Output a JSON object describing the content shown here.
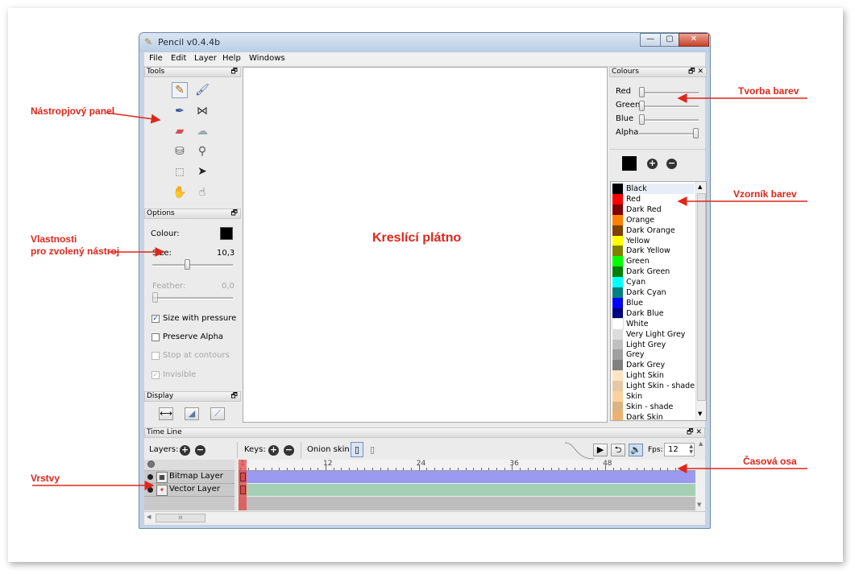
{
  "window": {
    "title": "Pencil v0.4.4b",
    "min": "—",
    "max": "▢",
    "close": "✕"
  },
  "menu": [
    "File",
    "Edit",
    "Layer",
    "Help",
    "Windows"
  ],
  "tools_panel": {
    "title": "Tools",
    "float": "🗗"
  },
  "options_panel": {
    "title": "Options",
    "float": "🗗",
    "colour_label": "Colour:",
    "colour_value": "#000000",
    "size_label": "Size:",
    "size_value": "10,3",
    "size_fraction": 0.43,
    "feather_label": "Feather:",
    "feather_value": "0,0",
    "checks": [
      {
        "label": "Size with pressure",
        "checked": true,
        "disabled": false
      },
      {
        "label": "Preserve Alpha",
        "checked": false,
        "disabled": false
      },
      {
        "label": "Stop at contours",
        "checked": false,
        "disabled": true
      },
      {
        "label": "Invisible",
        "checked": true,
        "disabled": true
      }
    ]
  },
  "display_panel": {
    "title": "Display",
    "float": "🗗",
    "btn1": "⟷",
    "btn2": "◢",
    "btn3": "⟋"
  },
  "colours_panel": {
    "title": "Colours",
    "float": "🗗",
    "close": "✕",
    "sliders": [
      {
        "label": "Red",
        "fraction": 0.0
      },
      {
        "label": "Green",
        "fraction": 0.0
      },
      {
        "label": "Blue",
        "fraction": 0.0
      },
      {
        "label": "Alpha",
        "fraction": 1.0
      }
    ],
    "current": "#000000",
    "add": "+",
    "remove": "−"
  },
  "swatches": [
    {
      "name": "Black",
      "color": "#000000"
    },
    {
      "name": "Red",
      "color": "#ff0000"
    },
    {
      "name": "Dark Red",
      "color": "#800000"
    },
    {
      "name": "Orange",
      "color": "#ff8000"
    },
    {
      "name": "Dark Orange",
      "color": "#804000"
    },
    {
      "name": "Yellow",
      "color": "#ffff00"
    },
    {
      "name": "Dark Yellow",
      "color": "#808000"
    },
    {
      "name": "Green",
      "color": "#00ff00"
    },
    {
      "name": "Dark Green",
      "color": "#008000"
    },
    {
      "name": "Cyan",
      "color": "#00ffff"
    },
    {
      "name": "Dark Cyan",
      "color": "#008080"
    },
    {
      "name": "Blue",
      "color": "#0000ff"
    },
    {
      "name": "Dark Blue",
      "color": "#000080"
    },
    {
      "name": "White",
      "color": "#ffffff"
    },
    {
      "name": "Very Light Grey",
      "color": "#dcdcdc"
    },
    {
      "name": "Light Grey",
      "color": "#c0c0c0"
    },
    {
      "name": "Grey",
      "color": "#a0a0a0"
    },
    {
      "name": "Dark Grey",
      "color": "#808080"
    },
    {
      "name": "Light Skin",
      "color": "#ffe4c4"
    },
    {
      "name": "Light Skin - shade",
      "color": "#e6c8a6"
    },
    {
      "name": "Skin",
      "color": "#fad2a0"
    },
    {
      "name": "Skin - shade",
      "color": "#dcb482"
    },
    {
      "name": "Dark Skin",
      "color": "#f0b070"
    }
  ],
  "timeline": {
    "title": "Time Line",
    "float": "🗗",
    "close": "✕",
    "layers_label": "Layers:",
    "keys_label": "Keys:",
    "onion_label": "Onion skin:",
    "fps_label": "Fps:",
    "fps_value": "12",
    "play": "▶",
    "loop": "⮌",
    "sound": "🔈",
    "frame_ticks": [
      "1",
      "12",
      "24",
      "36",
      "48"
    ],
    "layers": [
      {
        "name": "Bitmap Layer",
        "color": "#9a9af2"
      },
      {
        "name": "Vector Layer",
        "color": "#a4cfb4"
      }
    ],
    "scroll_grip": "III"
  },
  "annotations": {
    "tools": "Nástropjový panel",
    "options_1": "Vlastnosti",
    "options_2": "pro zvolený nástroj",
    "canvas": "Kreslící plátno",
    "colours": "Tvorba barev",
    "swatches": "Vzorník barev",
    "timeline": "Časová osa",
    "layers": "Vrstvy"
  },
  "accent": "#e0261a"
}
